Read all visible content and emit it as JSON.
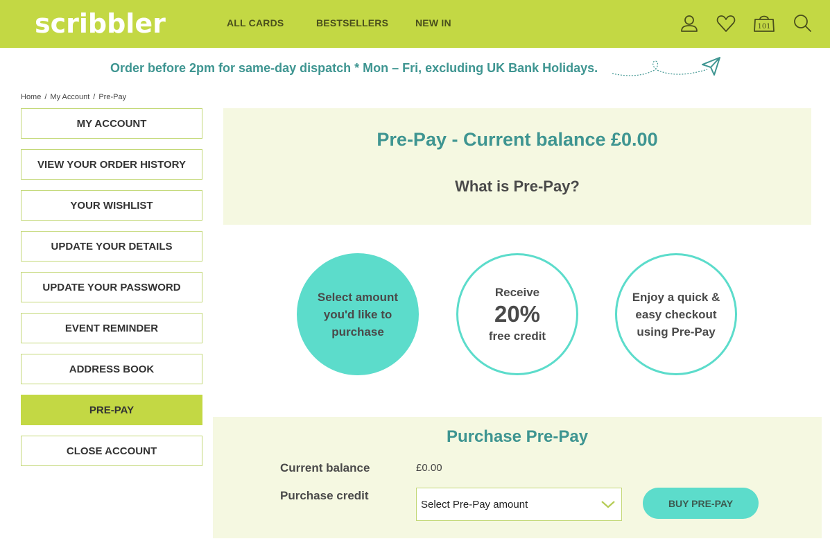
{
  "header": {
    "logo": "scribbler",
    "nav": [
      "ALL CARDS",
      "BESTSELLERS",
      "NEW IN"
    ],
    "icons": [
      "user-icon",
      "heart-icon",
      "bag-icon",
      "search-icon"
    ],
    "bag_count": "101"
  },
  "banner": {
    "text": "Order before 2pm for same-day dispatch * Mon – Fri, excluding UK Bank Holidays."
  },
  "breadcrumb": [
    "Home",
    "My Account",
    "Pre-Pay"
  ],
  "sidebar": {
    "items": [
      {
        "label": "MY ACCOUNT",
        "active": false
      },
      {
        "label": "VIEW YOUR ORDER HISTORY",
        "active": false
      },
      {
        "label": "YOUR WISHLIST",
        "active": false
      },
      {
        "label": "UPDATE YOUR DETAILS",
        "active": false
      },
      {
        "label": "UPDATE YOUR PASSWORD",
        "active": false
      },
      {
        "label": "EVENT REMINDER",
        "active": false
      },
      {
        "label": "ADDRESS BOOK",
        "active": false
      },
      {
        "label": "PRE-PAY",
        "active": true
      },
      {
        "label": "CLOSE ACCOUNT",
        "active": false
      }
    ]
  },
  "hero": {
    "title": "Pre-Pay - Current balance £0.00",
    "subtitle": "What is Pre-Pay?"
  },
  "steps": [
    {
      "lines": [
        "Select amount",
        "you'd like to",
        "purchase"
      ]
    },
    {
      "top": "Receive",
      "big": "20%",
      "bottom": "free credit"
    },
    {
      "lines": [
        "Enjoy a quick &",
        "easy checkout",
        "using Pre-Pay"
      ]
    }
  ],
  "purchase": {
    "title": "Purchase Pre-Pay",
    "balance_label": "Current balance",
    "balance_value": "£0.00",
    "credit_label": "Purchase credit",
    "select_placeholder": "Select Pre-Pay amount",
    "buy_label": "BUY PRE-PAY"
  },
  "colors": {
    "brand_lime": "#c3d844",
    "teal_text": "#3e9591",
    "aqua": "#5cdccb",
    "panel_bg": "#f5f8e1"
  }
}
